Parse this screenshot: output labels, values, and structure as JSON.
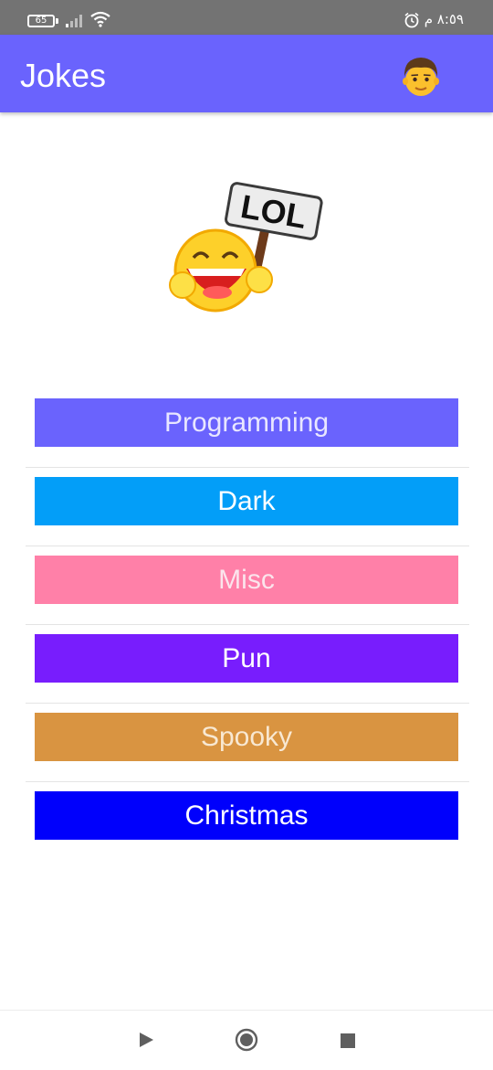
{
  "status_bar": {
    "battery_level": "65",
    "time": "٨:٥٩ م",
    "icons": [
      "battery-icon",
      "signal-icon",
      "wifi-icon",
      "alarm-icon"
    ]
  },
  "app_bar": {
    "title": "Jokes",
    "avatar_icon": "man-emoji-icon",
    "color": "#6a63fd"
  },
  "hero": {
    "icon": "laughing-emoji-lol-sign-icon",
    "sign_text": "LOL"
  },
  "categories": [
    {
      "label": "Programming",
      "color": "#6a63fd"
    },
    {
      "label": "Dark",
      "color": "#039ef8"
    },
    {
      "label": "Misc",
      "color": "#ff80a8"
    },
    {
      "label": "Pun",
      "color": "#781dfd"
    },
    {
      "label": "Spooky",
      "color": "#d99441"
    },
    {
      "label": "Christmas",
      "color": "#0000fc"
    }
  ],
  "nav_bar": {
    "icons": [
      "back-triangle-icon",
      "home-circle-icon",
      "recent-square-icon"
    ]
  }
}
